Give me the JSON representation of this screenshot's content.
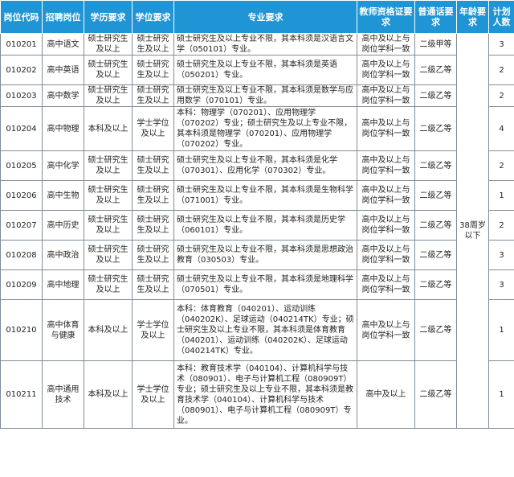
{
  "headers": [
    "岗位代码",
    "招聘岗位",
    "学历要求",
    "学位要求",
    "专业要求",
    "教师资格证要求",
    "普通话要求",
    "年龄要求",
    "计划人数"
  ],
  "age_requirement": "38周岁以下",
  "rows": [
    {
      "code": "010201",
      "post": "高中语文",
      "edu": "硕士研究生及以上",
      "degree": "硕士研究生及以上",
      "major": "硕士研究生及以上专业不限，其本科须是汉语言文学（050101）专业。",
      "cert": "高中及以上与岗位学科一致",
      "mandarin": "二级甲等",
      "count": "3"
    },
    {
      "code": "010202",
      "post": "高中英语",
      "edu": "硕士研究生及以上",
      "degree": "硕士研究生及以上",
      "major": "硕士研究生及以上专业不限，其本科须是英语（050201）专业。",
      "cert": "高中及以上与岗位学科一致",
      "mandarin": "二级乙等",
      "count": "2"
    },
    {
      "code": "010203",
      "post": "高中数学",
      "edu": "硕士研究生及以上",
      "degree": "硕士研究生及以上",
      "major": "硕士研究生及以上专业不限，其本科须是数学与应用数学（070101）专业。",
      "cert": "高中及以上与岗位学科一致",
      "mandarin": "二级乙等",
      "count": "2"
    },
    {
      "code": "010204",
      "post": "高中物理",
      "edu": "本科及以上",
      "degree": "学士学位及以上",
      "major": "本科：物理学（070201）、应用物理学（070202）专业；硕士研究生及以上专业不限，其本科须是物理学（070201）、应用物理学（070202）专业。",
      "cert": "高中及以上与岗位学科一致",
      "mandarin": "二级乙等",
      "count": "4"
    },
    {
      "code": "010205",
      "post": "高中化学",
      "edu": "硕士研究生及以上",
      "degree": "硕士研究生及以上",
      "major": "硕士研究生及以上专业不限，其本科须是化学（070301）、应用化学（070302）专业。",
      "cert": "高中及以上与岗位学科一致",
      "mandarin": "二级乙等",
      "count": "2"
    },
    {
      "code": "010206",
      "post": "高中生物",
      "edu": "硕士研究生及以上",
      "degree": "硕士研究生及以上",
      "major": "硕士研究生及以上专业不限，其本科须是生物科学（071001）专业。",
      "cert": "高中及以上与岗位学科一致",
      "mandarin": "二级乙等",
      "count": "1"
    },
    {
      "code": "010207",
      "post": "高中历史",
      "edu": "硕士研究生及以上",
      "degree": "硕士研究生及以上",
      "major": "硕士研究生及以上专业不限，其本科须是历史学（060101）专业。",
      "cert": "高中及以上与岗位学科一致",
      "mandarin": "二级乙等",
      "count": "2"
    },
    {
      "code": "010208",
      "post": "高中政治",
      "edu": "硕士研究生及以上",
      "degree": "硕士研究生及以上",
      "major": "硕士研究生及以上专业不限，其本科须是思想政治教育（030503）专业。",
      "cert": "高中及以上与岗位学科一致",
      "mandarin": "二级乙等",
      "count": "3"
    },
    {
      "code": "010209",
      "post": "高中地理",
      "edu": "硕士研究生及以上",
      "degree": "硕士研究生及以上",
      "major": "硕士研究生及以上专业不限，其本科须是地理科学（070501）专业。",
      "cert": "高中及以上与岗位学科一致",
      "mandarin": "二级乙等",
      "count": "3"
    },
    {
      "code": "010210",
      "post": "高中体育与健康",
      "edu": "本科及以上",
      "degree": "学士学位及以上",
      "major": "本科：体育教育（040201）、运动训练（040202K）、足球运动（040214TK）专业；硕士研究生及以上专业不限，其本科须是体育教育（040201）、运动训练（040202K）、足球运动（040214TK）专业。",
      "cert": "高中及以上与岗位学科一致",
      "mandarin": "二级乙等",
      "count": "1"
    },
    {
      "code": "010211",
      "post": "高中通用技术",
      "edu": "本科及以上",
      "degree": "学士学位及以上",
      "major": "本科：教育技术学（040104）、计算机科学与技术（080901）、电子与计算机工程（080909T）专业；硕士研究生及以上专业不限，其本科须是教育技术学（040104）、计算机科学与技术（080901）、电子与计算机工程（080909T）专业。",
      "cert": "高中及以上",
      "mandarin": "二级乙等",
      "count": "1"
    }
  ]
}
